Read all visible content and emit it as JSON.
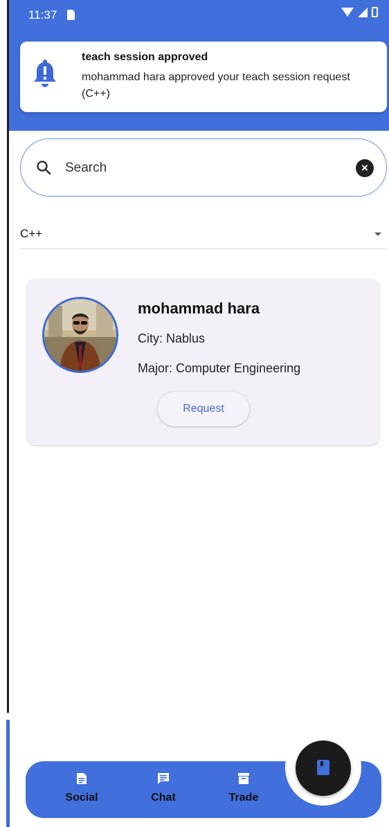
{
  "status_bar": {
    "time": "11:37"
  },
  "notification": {
    "title": "teach session approved",
    "body": "mohammad hara approved your teach session request (C++)",
    "icon": "bell-icon"
  },
  "search": {
    "placeholder": "Search",
    "value": ""
  },
  "filter": {
    "selected": "C++"
  },
  "results": [
    {
      "name": "mohammad hara",
      "city": "City: Nablus",
      "major": "Major: Computer Engineering",
      "action_label": "Request"
    }
  ],
  "bottom_nav": {
    "items": [
      {
        "label": "Social",
        "icon": "document-icon"
      },
      {
        "label": "Chat",
        "icon": "chat-icon"
      },
      {
        "label": "Trade",
        "icon": "archive-icon"
      }
    ],
    "fab_icon": "book-icon"
  },
  "colors": {
    "primary": "#416fdb",
    "card": "#f3f0f8",
    "fab": "#1b1b1b"
  }
}
